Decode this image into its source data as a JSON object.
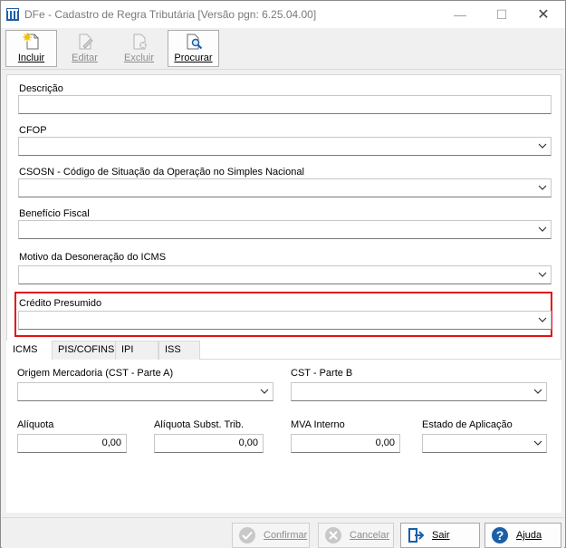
{
  "window": {
    "title": "DFe - Cadastro de Regra Tributária [Versão pgn: 6.25.04.00]",
    "controls": {
      "minimize": "—",
      "maximize": "☐",
      "close": "✕"
    }
  },
  "toolbar": {
    "incluir": "Incluir",
    "editar": "Editar",
    "excluir": "Excluir",
    "procurar": "Procurar"
  },
  "form": {
    "descricao": {
      "label": "Descrição",
      "value": ""
    },
    "cfop": {
      "label": "CFOP",
      "value": ""
    },
    "csosn": {
      "label": "CSOSN - Código de Situação da Operação no Simples Nacional",
      "value": ""
    },
    "beneficio": {
      "label": "Benefício Fiscal",
      "value": ""
    },
    "motivo": {
      "label": "Motivo da Desoneração do ICMS",
      "value": ""
    },
    "credito": {
      "label": "Crédito Presumido",
      "value": ""
    }
  },
  "tabs": [
    "ICMS",
    "PIS/COFINS",
    "IPI",
    "ISS"
  ],
  "active_tab": "ICMS",
  "icms": {
    "origem": {
      "label": "Origem Mercadoria (CST - Parte A)",
      "value": ""
    },
    "cst_b": {
      "label": "CST - Parte B",
      "value": ""
    },
    "aliquota": {
      "label": "Alíquota",
      "value": "0,00"
    },
    "aliquota_st": {
      "label": "Alíquota Subst. Trib.",
      "value": "0,00"
    },
    "mva": {
      "label": "MVA Interno",
      "value": "0,00"
    },
    "estado": {
      "label": "Estado de Aplicação",
      "value": ""
    }
  },
  "actions": {
    "confirmar": "Confirmar",
    "cancelar": "Cancelar",
    "sair": "Sair",
    "ajuda": "Ajuda"
  },
  "colors": {
    "highlight": "#e21212",
    "accent_blue": "#1a5fa8"
  }
}
